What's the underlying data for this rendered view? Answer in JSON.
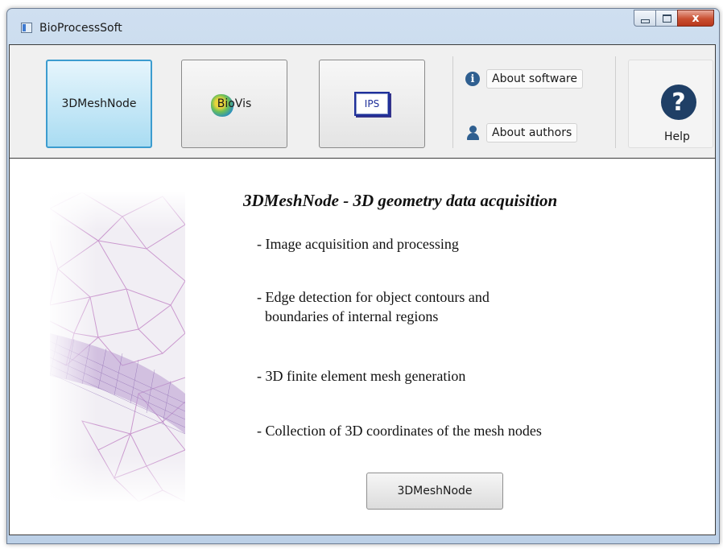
{
  "window": {
    "title": "BioProcessSoft",
    "controls": {
      "minimize": "",
      "maximize": "",
      "close": "x"
    }
  },
  "toolbar": {
    "mesh_button": "3DMeshNode",
    "biovis_button": "BioVis",
    "ips_button": "IPS",
    "about_software": "About software",
    "about_authors": "About authors",
    "help": "Help",
    "info_glyph": "i",
    "help_glyph": "?"
  },
  "content": {
    "heading": "3DMeshNode - 3D geometry data acquisition",
    "features": [
      "- Image acquisition and processing",
      "- Edge detection for object contours and",
      "boundaries of internal regions",
      "- 3D finite element mesh generation",
      "- Collection of 3D coordinates of the mesh nodes"
    ],
    "action_button": "3DMeshNode"
  },
  "colors": {
    "active_tool": "#a9dcf2",
    "active_border": "#3c9ccf",
    "mesh_lines": "#c48ac8",
    "help_icon": "#1f3f66"
  },
  "icons": [
    "app-icon",
    "biovis-icon",
    "ips-icon",
    "info-icon",
    "person-icon",
    "help-icon",
    "mesh-illustration"
  ]
}
